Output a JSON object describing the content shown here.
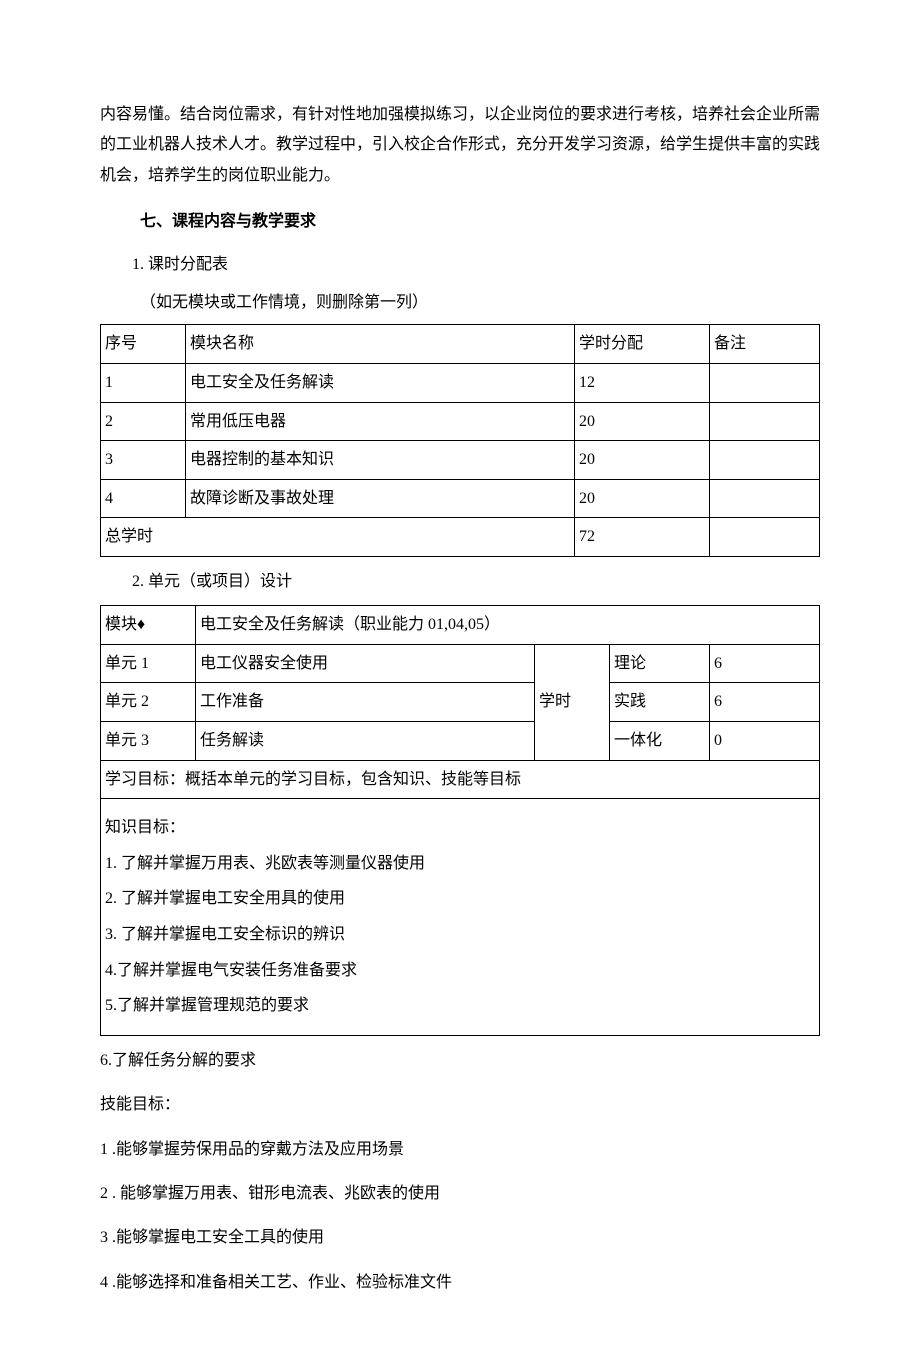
{
  "intro_para": "内容易懂。结合岗位需求，有针对性地加强模拟练习，以企业岗位的要求进行考核，培养社会企业所需的工业机器人技术人才。教学过程中，引入校企合作形式，充分开发学习资源，给学生提供丰富的实践机会，培养学生的岗位职业能力。",
  "section_heading": "七、课程内容与教学要求",
  "sub1": "1. 课时分配表",
  "sub1_note": "（如无模块或工作情境，则删除第一列）",
  "table1": {
    "headers": [
      "序号",
      "模块名称",
      "学时分配",
      "备注"
    ],
    "rows": [
      [
        "1",
        "电工安全及任务解读",
        "12",
        ""
      ],
      [
        "2",
        "常用低压电器",
        "20",
        ""
      ],
      [
        "3",
        "电器控制的基本知识",
        "20",
        ""
      ],
      [
        "4",
        "故障诊断及事故处理",
        "20",
        ""
      ]
    ],
    "total_label": "总学时",
    "total_value": "72"
  },
  "sub2": "2. 单元（或项目）设计",
  "table2": {
    "module_label": "模块♦",
    "module_value": "电工安全及任务解读（职业能力 01,04,05）",
    "hours_label": "学时",
    "rows": [
      {
        "unit": "单元 1",
        "name": "电工仪器安全使用",
        "type": "理论",
        "value": "6"
      },
      {
        "unit": "单元 2",
        "name": "工作准备",
        "type": "实践",
        "value": "6"
      },
      {
        "unit": "单元 3",
        "name": "任务解读",
        "type": "一体化",
        "value": "0"
      }
    ],
    "goal_heading": "学习目标：概括本单元的学习目标，包含知识、技能等目标",
    "knowledge_heading": "知识目标：",
    "knowledge_items": [
      "1. 了解并掌握万用表、兆欧表等测量仪器使用",
      "2. 了解并掌握电工安全用具的使用",
      "3. 了解并掌握电工安全标识的辨识",
      "4.了解并掌握电气安装任务准备要求",
      "5.了解并掌握管理规范的要求"
    ]
  },
  "after_table_item": "6.了解任务分解的要求",
  "skill_heading": "技能目标：",
  "skill_items": [
    "1 .能够掌握劳保用品的穿戴方法及应用场景",
    "2 . 能够掌握万用表、钳形电流表、兆欧表的使用",
    "3 .能够掌握电工安全工具的使用",
    "4 .能够选择和准备相关工艺、作业、检验标准文件"
  ]
}
